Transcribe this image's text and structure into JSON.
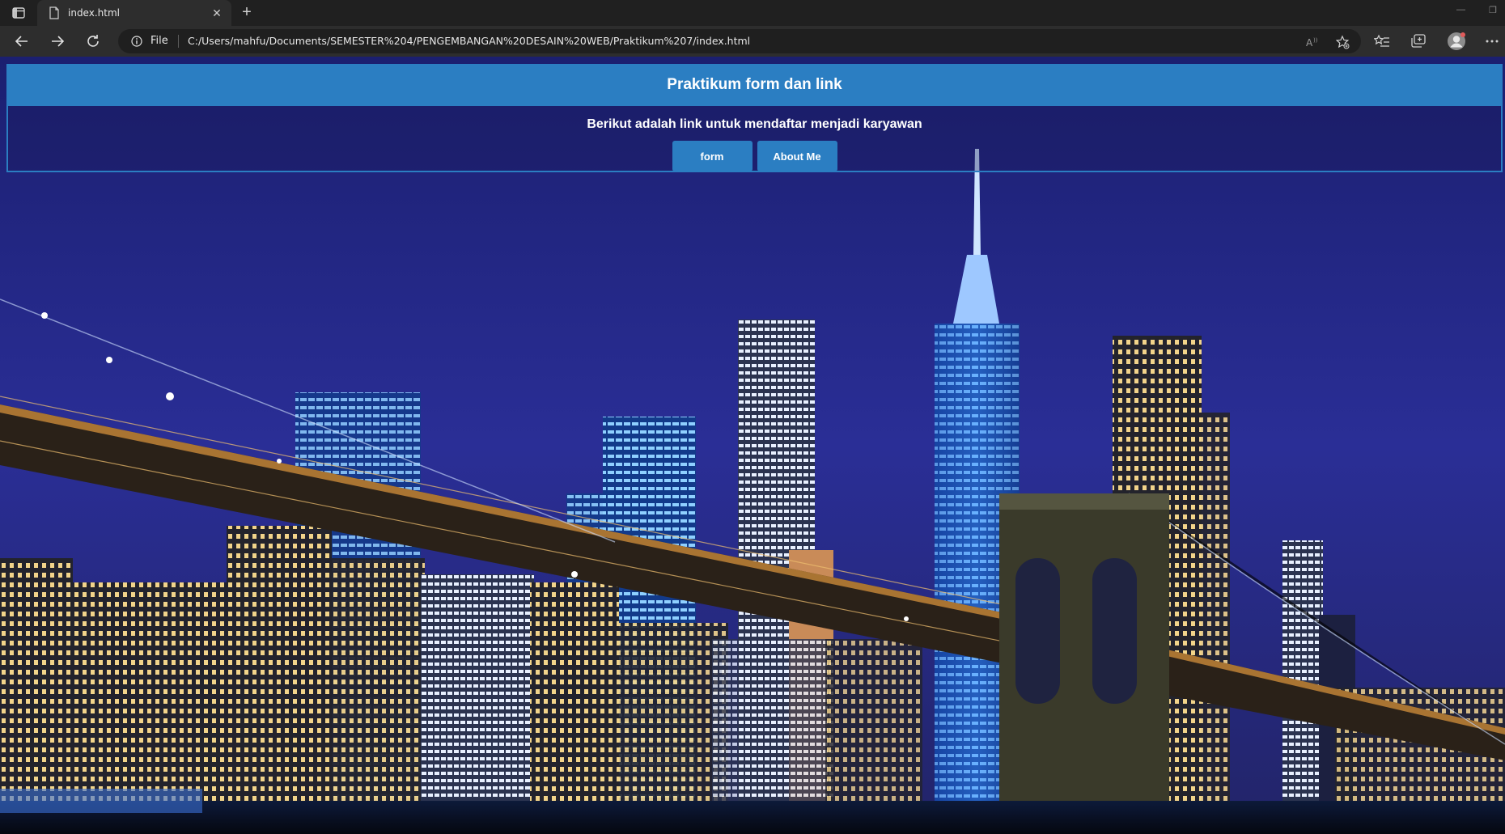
{
  "browser": {
    "tab_title": "index.html",
    "address_scheme": "File",
    "address_url": "C:/Users/mahfu/Documents/SEMESTER%204/PENGEMBANGAN%20DESAIN%20WEB/Praktikum%207/index.html",
    "icons": [
      "sidebar-icon",
      "page-icon",
      "close-icon",
      "plus-icon",
      "back-icon",
      "forward-icon",
      "refresh-icon",
      "info-icon",
      "read-aloud-icon",
      "favorite-add-icon",
      "favorites-icon",
      "collections-icon",
      "profile-icon",
      "more-icon"
    ]
  },
  "page": {
    "header_title": "Praktikum form dan link",
    "lead_text": "Berikut adalah link untuk mendaftar menjadi karyawan",
    "buttons": [
      {
        "label": "form"
      },
      {
        "label": "About Me"
      }
    ],
    "background_image": "night city skyline with illuminated suspension bridge",
    "colors": {
      "accent": "#2b7ec2",
      "text": "#ffffff",
      "sky": "#262a8a"
    }
  }
}
